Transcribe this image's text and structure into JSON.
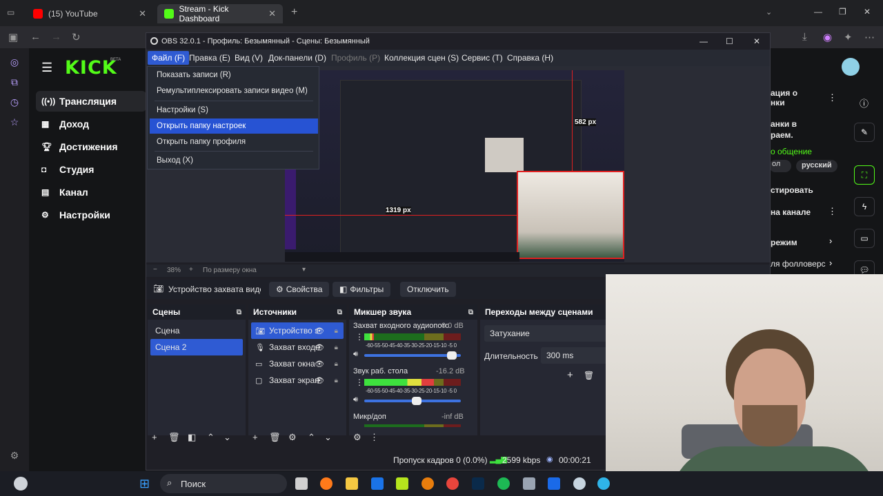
{
  "browser": {
    "tabs": [
      {
        "label": "(15) YouTube",
        "active": false
      },
      {
        "label": "Stream - Kick Dashboard",
        "active": true
      }
    ],
    "new_tab": "+"
  },
  "kick": {
    "logo": "KICK",
    "logo_badge": "BETA",
    "nav": [
      {
        "label": "Трансляция",
        "icon": "broadcast-icon",
        "active": true
      },
      {
        "label": "Доход",
        "icon": "revenue-icon",
        "active": false
      },
      {
        "label": "Достижения",
        "icon": "trophy-icon",
        "active": false
      },
      {
        "label": "Студия",
        "icon": "studio-icon",
        "active": false
      },
      {
        "label": "Канал",
        "icon": "channel-icon",
        "active": false
      },
      {
        "label": "Настройки",
        "icon": "gear-icon",
        "active": false
      }
    ],
    "right_fragments": [
      "ация о",
      "нки",
      "анки в",
      "раем.",
      "о общение",
      "русский",
      "стировать",
      "на канале",
      "режим",
      "ля фолловерс"
    ],
    "accent": "#53fc18"
  },
  "obs": {
    "title": "OBS 32.0.1 - Профиль: Безымянный - Сцены: Безымянный",
    "menu": [
      {
        "label": "Файл (F)",
        "state": "open"
      },
      {
        "label": "Правка (E)",
        "state": "normal"
      },
      {
        "label": "Вид (V)",
        "state": "normal"
      },
      {
        "label": "Док-панели (D)",
        "state": "normal"
      },
      {
        "label": "Профиль (P)",
        "state": "disabled"
      },
      {
        "label": "Коллекция сцен (S)",
        "state": "normal"
      },
      {
        "label": "Сервис (T)",
        "state": "normal"
      },
      {
        "label": "Справка (H)",
        "state": "normal"
      }
    ],
    "file_menu": [
      {
        "label": "Показать записи (R)",
        "highlighted": false
      },
      {
        "label": "Ремультиплексировать записи видео (M)",
        "highlighted": false
      },
      {
        "label": "Настройки (S)",
        "highlighted": false
      },
      {
        "label": "Открыть папку настроек",
        "highlighted": true
      },
      {
        "label": "Открыть папку профиля",
        "highlighted": false
      },
      {
        "label": "Выход (X)",
        "highlighted": false
      }
    ],
    "preview_labels": {
      "height": "582 px",
      "width": "1319 px"
    },
    "zoom": {
      "minus": "−",
      "value": "38%",
      "plus": "+",
      "fit": "По размеру окна"
    },
    "source_bar": {
      "source_name": "Устройство захвата видео",
      "properties": "Свойства",
      "filters": "Фильтры",
      "deactivate": "Отключить"
    },
    "scenes": {
      "title": "Сцены",
      "items": [
        {
          "label": "Сцена",
          "selected": false
        },
        {
          "label": "Сцена 2",
          "selected": true
        }
      ]
    },
    "sources": {
      "title": "Источники",
      "items": [
        {
          "label": "Устройство з",
          "icon": "camera-icon",
          "selected": true
        },
        {
          "label": "Захват входн",
          "icon": "microphone-icon",
          "selected": false
        },
        {
          "label": "Захват окна",
          "icon": "window-icon",
          "selected": false
        },
        {
          "label": "Захват экран",
          "icon": "monitor-icon",
          "selected": false
        }
      ]
    },
    "mixer": {
      "title": "Микшер звука",
      "scale": "-60-55-50-45-40-35-30-25-20-15-10 -5 0",
      "channels": [
        {
          "name": "Захват входного аудиопотока",
          "db": "0.0 dB",
          "level": 0.1,
          "volume": 0.95
        },
        {
          "name": "Звук раб. стола",
          "db": "-16.2 dB",
          "level": 0.72,
          "volume": 0.55
        },
        {
          "name": "Микр/доп",
          "db": "-inf dB",
          "level": 0.0,
          "volume": 0.9
        }
      ]
    },
    "transitions": {
      "title": "Переходы между сценами",
      "type": "Затухание",
      "duration_label": "Длительность",
      "duration_value": "300 ms"
    },
    "status": {
      "dropped": "Пропуск кадров 0 (0.0%)",
      "bitrate": "2599 kbps",
      "time": "00:00:21"
    }
  },
  "taskbar": {
    "search": "Поиск"
  }
}
